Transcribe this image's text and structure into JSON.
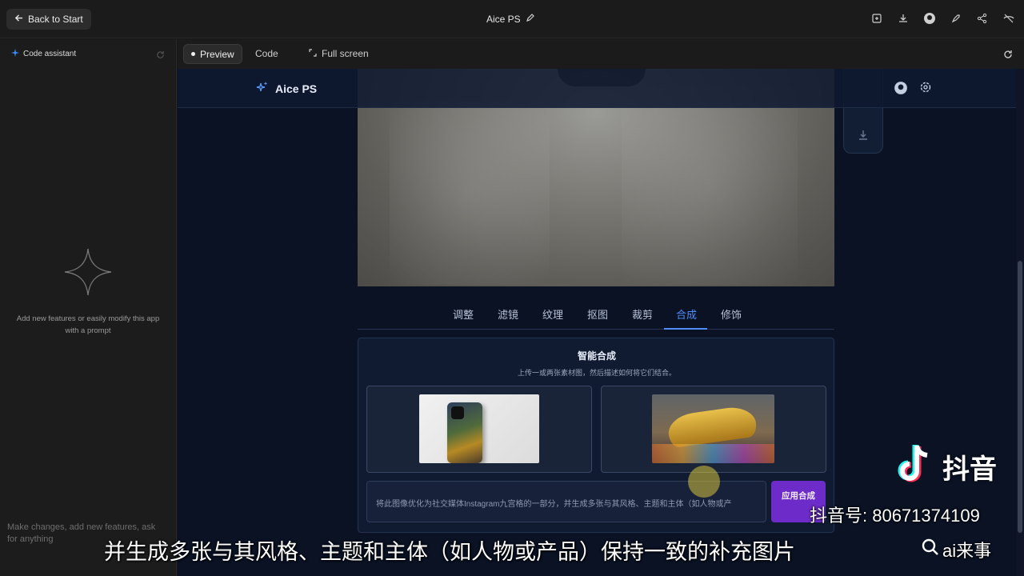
{
  "topbar": {
    "back_label": "Back to Start",
    "app_title": "Aice PS"
  },
  "sidebar": {
    "assistant_label": "Code assistant",
    "hint": "Add new features or easily modify this app with a prompt",
    "input_placeholder": "Make changes, add new features, ask for anything"
  },
  "subbar": {
    "preview_label": "Preview",
    "code_label": "Code",
    "fullscreen_label": "Full screen"
  },
  "app": {
    "brand": "Aice PS",
    "tabs": [
      {
        "label": "调整"
      },
      {
        "label": "滤镜"
      },
      {
        "label": "纹理"
      },
      {
        "label": "抠图"
      },
      {
        "label": "裁剪"
      },
      {
        "label": "合成"
      },
      {
        "label": "修饰"
      }
    ],
    "active_tab": "合成",
    "panel": {
      "title": "智能合成",
      "subtitle": "上传一或两张素材图，然后描述如何将它们结合。",
      "prompt_text": "将此图像优化为社交媒体Instagram九宫格的一部分，并生成多张与其风格、主题和主体（如人物或产",
      "apply_label": "应用合成"
    }
  },
  "overlay": {
    "tiktok_name": "抖音",
    "tiktok_id": "抖音号: 80671374109",
    "subtitle": "并生成多张与其风格、主题和主体（如人物或产品）保持一致的补充图片",
    "channel": "ai来事"
  },
  "colors": {
    "accent_blue": "#4f8df7",
    "apply_purple": "#6d2cc9",
    "app_bg": "#0a1224"
  }
}
